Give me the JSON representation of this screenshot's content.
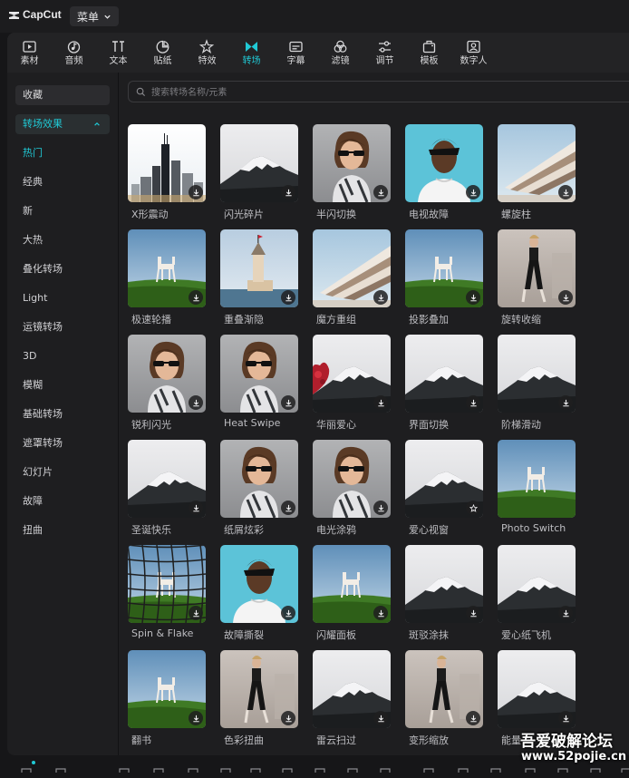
{
  "app": {
    "name": "CapCut",
    "menu_label": "菜单"
  },
  "toolbar": [
    {
      "label": "素材",
      "icon": "media-icon",
      "active": false
    },
    {
      "label": "音频",
      "icon": "audio-icon",
      "active": false
    },
    {
      "label": "文本",
      "icon": "text-icon",
      "active": false
    },
    {
      "label": "贴纸",
      "icon": "sticker-icon",
      "active": false
    },
    {
      "label": "特效",
      "icon": "effects-icon",
      "active": false
    },
    {
      "label": "转场",
      "icon": "transition-icon",
      "active": true
    },
    {
      "label": "字幕",
      "icon": "caption-icon",
      "active": false
    },
    {
      "label": "滤镜",
      "icon": "filter-icon",
      "active": false
    },
    {
      "label": "调节",
      "icon": "adjust-icon",
      "active": false
    },
    {
      "label": "模板",
      "icon": "template-icon",
      "active": false
    },
    {
      "label": "数字人",
      "icon": "avatar-icon",
      "active": false
    }
  ],
  "sidebar": {
    "favorites": "收藏",
    "category": "转场效果",
    "items": [
      "热门",
      "经典",
      "新",
      "大热",
      "叠化转场",
      "Light",
      "运镜转场",
      "3D",
      "模糊",
      "基础转场",
      "遮罩转场",
      "幻灯片",
      "故障",
      "扭曲"
    ],
    "active_item": "热门"
  },
  "search": {
    "placeholder": "搜索转场名称/元素"
  },
  "cards": [
    {
      "label": "X形震动",
      "scene": "city"
    },
    {
      "label": "闪光碎片",
      "scene": "mountain"
    },
    {
      "label": "半闪切换",
      "scene": "person"
    },
    {
      "label": "电视故障",
      "scene": "man"
    },
    {
      "label": "螺旋柱",
      "scene": "building"
    },
    {
      "label": "极速轮播",
      "scene": "field"
    },
    {
      "label": "重叠渐隐",
      "scene": "tower"
    },
    {
      "label": "魔方重组",
      "scene": "building"
    },
    {
      "label": "投影叠加",
      "scene": "field"
    },
    {
      "label": "旋转收缩",
      "scene": "woman"
    },
    {
      "label": "锐利闪光",
      "scene": "person"
    },
    {
      "label": "Heat Swipe",
      "scene": "person"
    },
    {
      "label": "华丽爱心",
      "scene": "mountain-heart"
    },
    {
      "label": "界面切换",
      "scene": "mountain"
    },
    {
      "label": "阶梯滑动",
      "scene": "mountain"
    },
    {
      "label": "圣诞快乐",
      "scene": "mountain"
    },
    {
      "label": "纸屑炫彩",
      "scene": "person"
    },
    {
      "label": "电光涂鸦",
      "scene": "person"
    },
    {
      "label": "爱心视窗",
      "scene": "mountain",
      "badge": "star"
    },
    {
      "label": "Photo Switch",
      "scene": "field",
      "badge": "none"
    },
    {
      "label": "Spin & Flake",
      "scene": "field-net"
    },
    {
      "label": "故障撕裂",
      "scene": "man"
    },
    {
      "label": "闪耀面板",
      "scene": "field"
    },
    {
      "label": "斑驳涂抹",
      "scene": "mountain"
    },
    {
      "label": "爱心纸飞机",
      "scene": "mountain"
    },
    {
      "label": "翻书",
      "scene": "field"
    },
    {
      "label": "色彩扭曲",
      "scene": "woman"
    },
    {
      "label": "雷云扫过",
      "scene": "mountain"
    },
    {
      "label": "变形缩放",
      "scene": "woman"
    },
    {
      "label": "能量",
      "scene": "mountain"
    }
  ],
  "watermark": {
    "line1": "吾爱破解论坛",
    "line2": "www.52pojie.cn"
  }
}
